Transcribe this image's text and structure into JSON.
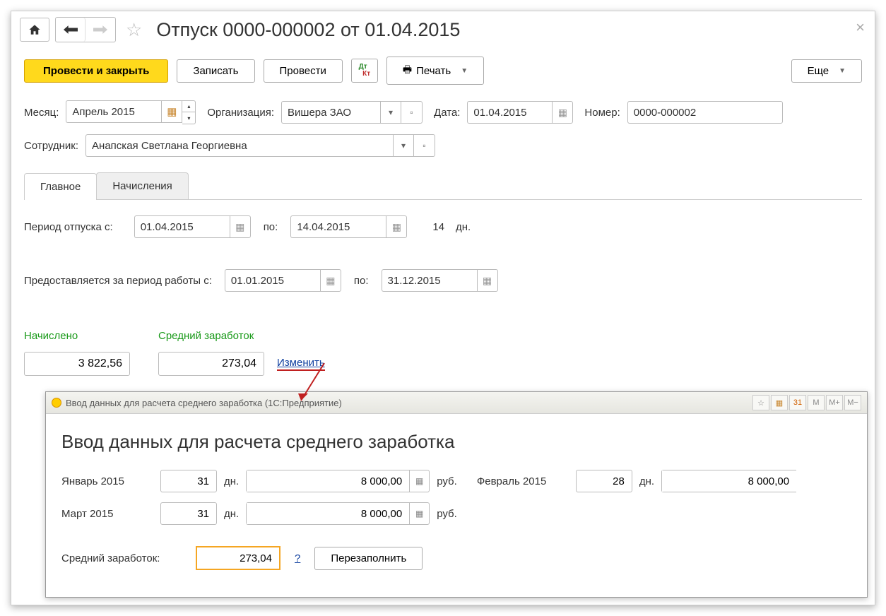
{
  "header": {
    "title": "Отпуск 0000-000002 от 01.04.2015"
  },
  "toolbar": {
    "post_close": "Провести и закрыть",
    "save": "Записать",
    "post": "Провести",
    "print": "Печать",
    "more": "Еще"
  },
  "fields": {
    "month_label": "Месяц:",
    "month_value": "Апрель 2015",
    "org_label": "Организация:",
    "org_value": "Вишера ЗАО",
    "date_label": "Дата:",
    "date_value": "01.04.2015",
    "number_label": "Номер:",
    "number_value": "0000-000002",
    "employee_label": "Сотрудник:",
    "employee_value": "Анапская Светлана Георгиевна"
  },
  "tabs": {
    "main": "Главное",
    "accruals": "Начисления"
  },
  "vacation": {
    "period_from_label": "Период отпуска с:",
    "from": "01.04.2015",
    "to_label": "по:",
    "to": "14.04.2015",
    "days": "14",
    "days_unit": "дн.",
    "work_period_label": "Предоставляется за период работы с:",
    "work_from": "01.01.2015",
    "work_to": "31.12.2015",
    "accrued_label": "Начислено",
    "accrued_value": "3 822,56",
    "avg_label": "Средний заработок",
    "avg_value": "273,04",
    "change_link": "Изменить"
  },
  "popup": {
    "titlebar": "Ввод данных для расчета среднего заработка  (1С:Предприятие)",
    "heading": "Ввод данных для расчета среднего заработка",
    "months": [
      {
        "name": "Январь 2015",
        "days": "31",
        "amount": "8 000,00"
      },
      {
        "name": "Февраль 2015",
        "days": "28",
        "amount": "8 000,00"
      },
      {
        "name": "Март 2015",
        "days": "31",
        "amount": "8 000,00"
      }
    ],
    "days_unit": "дн.",
    "amount_unit": "руб.",
    "avg_label": "Средний заработок:",
    "avg_value": "273,04",
    "question": "?",
    "refill": "Перезаполнить",
    "toolbar_buttons": [
      "M",
      "M+",
      "M−"
    ]
  }
}
